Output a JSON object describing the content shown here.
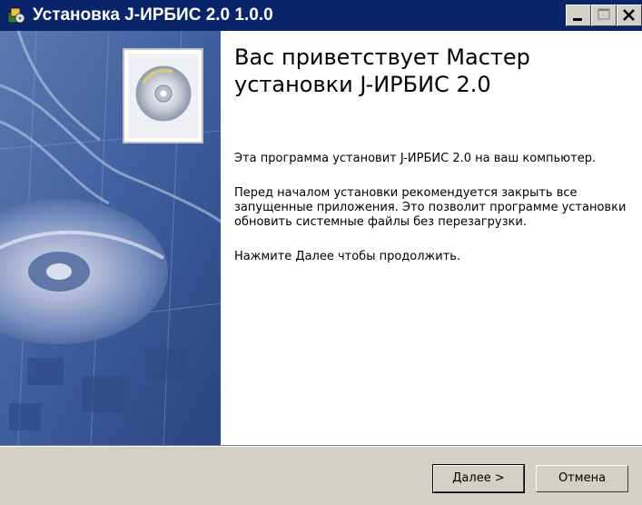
{
  "window": {
    "title": "Установка J-ИРБИС 2.0 1.0.0",
    "controls": {
      "minimize": "minimize-icon",
      "maximize": "maximize-icon",
      "close": "close-icon"
    }
  },
  "welcome": {
    "heading": "Вас приветствует Мастер установки J-ИРБИС 2.0",
    "line1": "Эта программа установит J-ИРБИС 2.0 на ваш компьютер.",
    "line2": "Перед началом установки рекомендуется закрыть все запущенные приложения. Это позволит программе установки обновить системные файлы без перезагрузки.",
    "line3": "Нажмите Далее чтобы продолжить."
  },
  "buttons": {
    "next": "Далее >",
    "cancel": "Отмена"
  },
  "colors": {
    "titlebar": "#0a246a",
    "dialog_bg": "#d4d0c8",
    "panel_bg": "#ffffff",
    "image_blue": "#3a5c9c"
  }
}
